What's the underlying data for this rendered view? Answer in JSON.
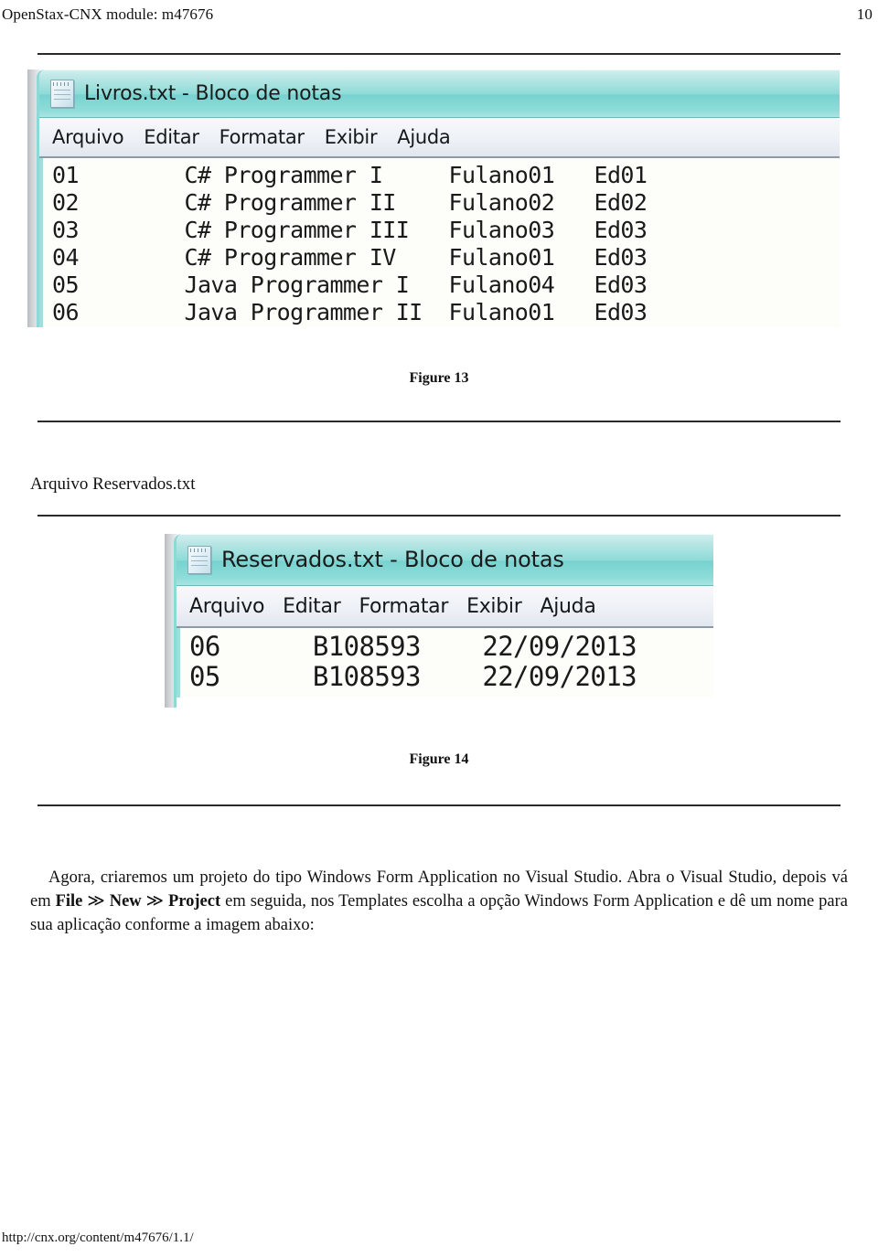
{
  "header": {
    "module_label": "OpenStax-CNX module: m47676",
    "page_number": "10"
  },
  "figures": [
    {
      "caption": "Figure 13",
      "window": {
        "icon": "notepad-icon",
        "title": "Livros.txt - Bloco de notas",
        "menu": [
          "Arquivo",
          "Editar",
          "Formatar",
          "Exibir",
          "Ajuda"
        ],
        "content_lines": [
          "01        C# Programmer I     Fulano01   Ed01",
          "02        C# Programmer II    Fulano02   Ed02",
          "03        C# Programmer III   Fulano03   Ed03",
          "04        C# Programmer IV    Fulano01   Ed03",
          "05        Java Programmer I   Fulano04   Ed03",
          "06        Java Programmer II  Fulano01   Ed03"
        ]
      }
    },
    {
      "caption": "Figure 14",
      "window": {
        "icon": "notepad-icon",
        "title": "Reservados.txt - Bloco de notas",
        "menu": [
          "Arquivo",
          "Editar",
          "Formatar",
          "Exibir",
          "Ajuda"
        ],
        "content_lines": [
          "06      B108593    22/09/2013",
          "05      B108593    22/09/2013"
        ]
      }
    }
  ],
  "section_heading": "Arquivo Reservados.txt",
  "paragraph": {
    "part1": "Agora, criaremos um projeto do tipo Windows Form Application no Visual Studio. Abra o Visual Studio, depois vá em ",
    "bold1": "File",
    "sep1": " ≫ ",
    "bold2": "New",
    "sep2": " ≫ ",
    "bold3": "Project",
    "part2": " em seguida, nos Templates escolha a opção Windows Form Application e dê um nome para sua aplicação conforme a imagem abaixo:"
  },
  "footer": {
    "url": "http://cnx.org/content/m47676/1.1/"
  },
  "colors": {
    "titlebar_teal": "#8ddbd8",
    "menubar_gray": "#eef1f6",
    "rule_black": "#2a2a2a"
  }
}
